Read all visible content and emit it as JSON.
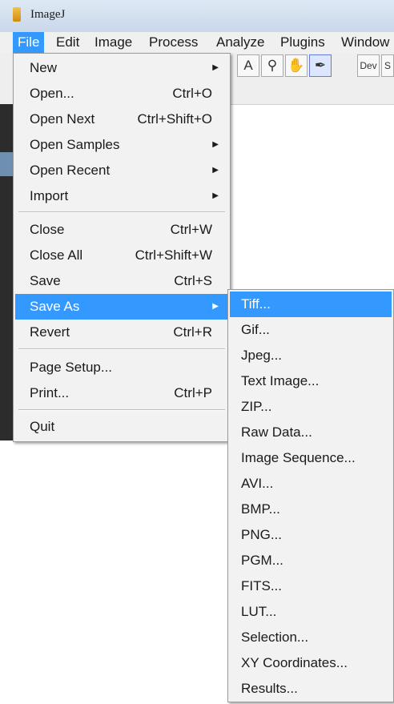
{
  "window": {
    "title": "ImageJ"
  },
  "menubar": {
    "items": [
      "File",
      "Edit",
      "Image",
      "Process",
      "Analyze",
      "Plugins",
      "Window"
    ]
  },
  "toolbar": {
    "text_tool": "A",
    "magnifier": "⚲",
    "hand": "✋",
    "dropper": "✒",
    "dev": "Dev",
    "stack": "S"
  },
  "file_menu": {
    "items": [
      {
        "label": "New",
        "shortcut": "",
        "submenu": true
      },
      {
        "label": "Open...",
        "shortcut": "Ctrl+O",
        "submenu": false
      },
      {
        "label": "Open Next",
        "shortcut": "Ctrl+Shift+O",
        "submenu": false
      },
      {
        "label": "Open Samples",
        "shortcut": "",
        "submenu": true
      },
      {
        "label": "Open Recent",
        "shortcut": "",
        "submenu": true
      },
      {
        "label": "Import",
        "shortcut": "",
        "submenu": true
      },
      {
        "label": "Close",
        "shortcut": "Ctrl+W",
        "submenu": false
      },
      {
        "label": "Close All",
        "shortcut": "Ctrl+Shift+W",
        "submenu": false
      },
      {
        "label": "Save",
        "shortcut": "Ctrl+S",
        "submenu": false
      },
      {
        "label": "Save As",
        "shortcut": "",
        "submenu": true
      },
      {
        "label": "Revert",
        "shortcut": "Ctrl+R",
        "submenu": false
      },
      {
        "label": "Page Setup...",
        "shortcut": "",
        "submenu": false
      },
      {
        "label": "Print...",
        "shortcut": "Ctrl+P",
        "submenu": false
      },
      {
        "label": "Quit",
        "shortcut": "",
        "submenu": false
      }
    ],
    "arrow": "▶"
  },
  "save_as_menu": {
    "items": [
      "Tiff...",
      "Gif...",
      "Jpeg...",
      "Text Image...",
      "ZIP...",
      "Raw Data...",
      "Image Sequence...",
      "AVI...",
      "BMP...",
      "PNG...",
      "PGM...",
      "FITS...",
      "LUT...",
      "Selection...",
      "XY Coordinates...",
      "Results..."
    ]
  },
  "colors": {
    "highlight": "#3399ff",
    "menu_bg": "#f2f2f2"
  }
}
